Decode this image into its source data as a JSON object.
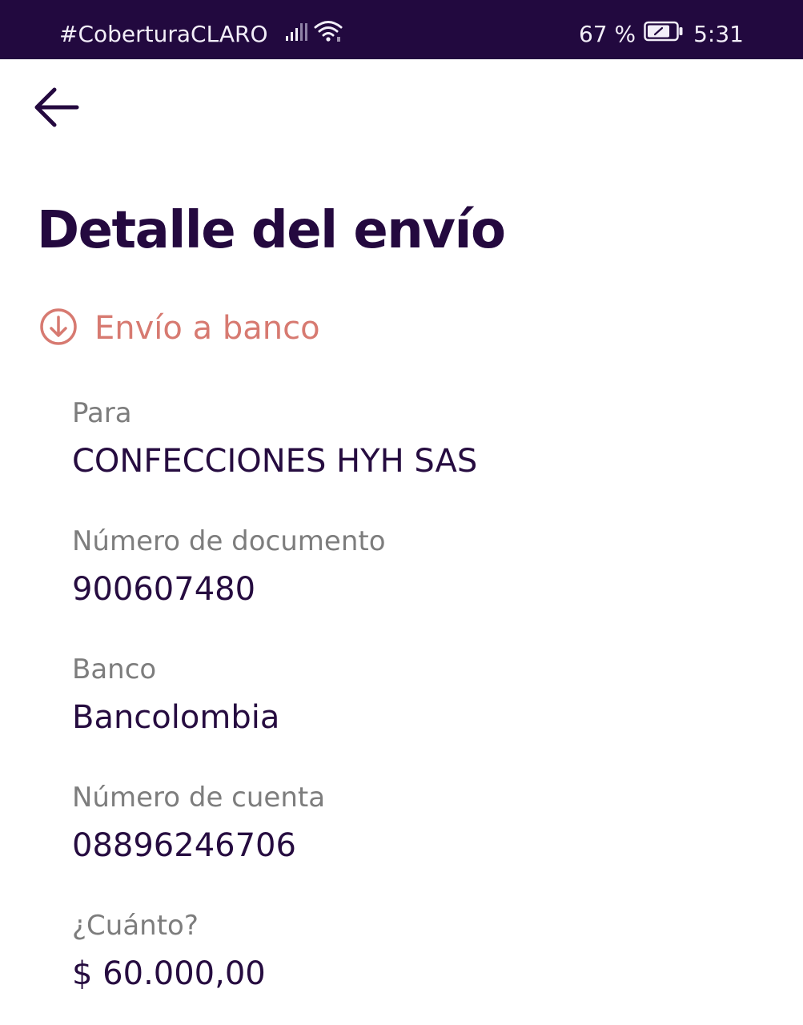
{
  "status_bar": {
    "carrier": "#CoberturaCLARO",
    "battery_percent": "67 %",
    "time": "5:31",
    "icons": [
      "signal-icon",
      "wifi-icon",
      "battery-icon"
    ]
  },
  "header": {
    "back_icon": "arrow-left-icon",
    "title": "Detalle del envío"
  },
  "transaction_type": {
    "icon": "arrow-down-circle-icon",
    "label": "Envío a banco",
    "color": "#d77a71"
  },
  "details": [
    {
      "label": "Para",
      "value": "CONFECCIONES HYH SAS"
    },
    {
      "label": "Número de documento",
      "value": "900607480"
    },
    {
      "label": "Banco",
      "value": "Bancolombia"
    },
    {
      "label": "Número de cuenta",
      "value": "08896246706"
    },
    {
      "label": "¿Cuánto?",
      "value": "$ 60.000,00"
    }
  ],
  "colors": {
    "status_bar_bg": "#22093f",
    "primary_text": "#24093f",
    "label_text": "#7d7d7d",
    "accent": "#d77a71"
  }
}
